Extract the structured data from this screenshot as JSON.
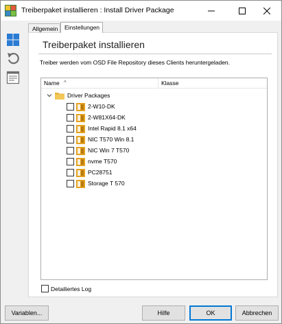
{
  "window": {
    "title": "Treiberpaket installieren : Install Driver Package",
    "app_icon": "baramundi-logo-icon",
    "controls": [
      "minimize-icon",
      "maximize-icon",
      "close-icon"
    ]
  },
  "left_toolbar": {
    "items": [
      {
        "icon": "windows-grid-icon",
        "color": "#2a7bd4"
      },
      {
        "icon": "undo-icon",
        "color": "#6d6d6d"
      },
      {
        "icon": "properties-icon",
        "color": "#6d6d6d"
      }
    ]
  },
  "tabs": [
    {
      "label": "Allgemein",
      "active": false
    },
    {
      "label": "Einstellungen",
      "active": true
    }
  ],
  "panel": {
    "heading": "Treiberpaket installieren",
    "description": "Treiber werden vom OSD File Repository dieses Clients heruntergeladen."
  },
  "tree": {
    "columns": {
      "name": "Name",
      "sort_icon": "^",
      "klasse": "Klasse"
    },
    "root": {
      "label": "Driver Packages",
      "expanded": true
    },
    "items": [
      {
        "label": "2-W10-DK",
        "checked": false
      },
      {
        "label": "2-W81X64-DK",
        "checked": false
      },
      {
        "label": "Intel Rapid 8.1 x64",
        "checked": false
      },
      {
        "label": "NIC T570 Win 8.1",
        "checked": false
      },
      {
        "label": "NIC Win 7 T570",
        "checked": false
      },
      {
        "label": "nvme T570",
        "checked": false
      },
      {
        "label": "PC28751",
        "checked": false
      },
      {
        "label": "Storage T 570",
        "checked": false
      }
    ]
  },
  "detailed_log": {
    "label": "Detailiertes Log",
    "checked": false
  },
  "buttons": {
    "variablen": "Variablen...",
    "hilfe": "Hilfe",
    "ok": "OK",
    "abbrechen": "Abbrechen"
  },
  "colors": {
    "accent": "#0078d7",
    "folder": "#e8b23a",
    "package": "#e4a21f"
  }
}
